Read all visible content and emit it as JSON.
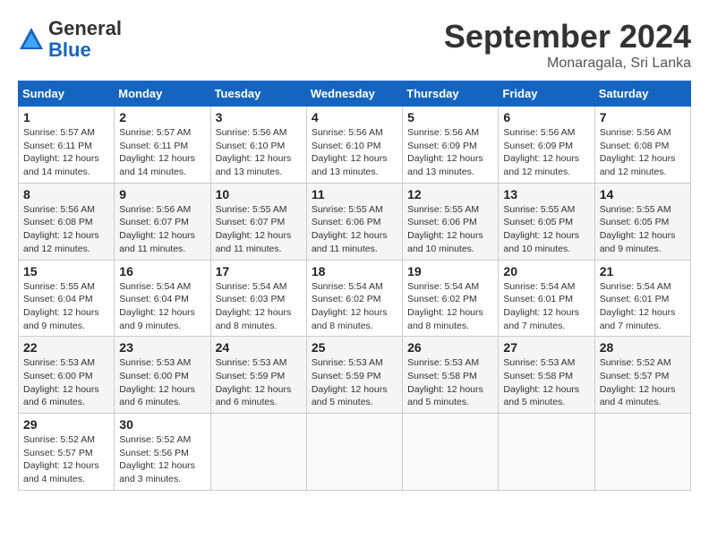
{
  "header": {
    "logo_line1": "General",
    "logo_line2": "Blue",
    "month": "September 2024",
    "location": "Monaragala, Sri Lanka"
  },
  "weekdays": [
    "Sunday",
    "Monday",
    "Tuesday",
    "Wednesday",
    "Thursday",
    "Friday",
    "Saturday"
  ],
  "weeks": [
    [
      {
        "day": "1",
        "info": "Sunrise: 5:57 AM\nSunset: 6:11 PM\nDaylight: 12 hours\nand 14 minutes."
      },
      {
        "day": "2",
        "info": "Sunrise: 5:57 AM\nSunset: 6:11 PM\nDaylight: 12 hours\nand 14 minutes."
      },
      {
        "day": "3",
        "info": "Sunrise: 5:56 AM\nSunset: 6:10 PM\nDaylight: 12 hours\nand 13 minutes."
      },
      {
        "day": "4",
        "info": "Sunrise: 5:56 AM\nSunset: 6:10 PM\nDaylight: 12 hours\nand 13 minutes."
      },
      {
        "day": "5",
        "info": "Sunrise: 5:56 AM\nSunset: 6:09 PM\nDaylight: 12 hours\nand 13 minutes."
      },
      {
        "day": "6",
        "info": "Sunrise: 5:56 AM\nSunset: 6:09 PM\nDaylight: 12 hours\nand 12 minutes."
      },
      {
        "day": "7",
        "info": "Sunrise: 5:56 AM\nSunset: 6:08 PM\nDaylight: 12 hours\nand 12 minutes."
      }
    ],
    [
      {
        "day": "8",
        "info": "Sunrise: 5:56 AM\nSunset: 6:08 PM\nDaylight: 12 hours\nand 12 minutes."
      },
      {
        "day": "9",
        "info": "Sunrise: 5:56 AM\nSunset: 6:07 PM\nDaylight: 12 hours\nand 11 minutes."
      },
      {
        "day": "10",
        "info": "Sunrise: 5:55 AM\nSunset: 6:07 PM\nDaylight: 12 hours\nand 11 minutes."
      },
      {
        "day": "11",
        "info": "Sunrise: 5:55 AM\nSunset: 6:06 PM\nDaylight: 12 hours\nand 11 minutes."
      },
      {
        "day": "12",
        "info": "Sunrise: 5:55 AM\nSunset: 6:06 PM\nDaylight: 12 hours\nand 10 minutes."
      },
      {
        "day": "13",
        "info": "Sunrise: 5:55 AM\nSunset: 6:05 PM\nDaylight: 12 hours\nand 10 minutes."
      },
      {
        "day": "14",
        "info": "Sunrise: 5:55 AM\nSunset: 6:05 PM\nDaylight: 12 hours\nand 9 minutes."
      }
    ],
    [
      {
        "day": "15",
        "info": "Sunrise: 5:55 AM\nSunset: 6:04 PM\nDaylight: 12 hours\nand 9 minutes."
      },
      {
        "day": "16",
        "info": "Sunrise: 5:54 AM\nSunset: 6:04 PM\nDaylight: 12 hours\nand 9 minutes."
      },
      {
        "day": "17",
        "info": "Sunrise: 5:54 AM\nSunset: 6:03 PM\nDaylight: 12 hours\nand 8 minutes."
      },
      {
        "day": "18",
        "info": "Sunrise: 5:54 AM\nSunset: 6:02 PM\nDaylight: 12 hours\nand 8 minutes."
      },
      {
        "day": "19",
        "info": "Sunrise: 5:54 AM\nSunset: 6:02 PM\nDaylight: 12 hours\nand 8 minutes."
      },
      {
        "day": "20",
        "info": "Sunrise: 5:54 AM\nSunset: 6:01 PM\nDaylight: 12 hours\nand 7 minutes."
      },
      {
        "day": "21",
        "info": "Sunrise: 5:54 AM\nSunset: 6:01 PM\nDaylight: 12 hours\nand 7 minutes."
      }
    ],
    [
      {
        "day": "22",
        "info": "Sunrise: 5:53 AM\nSunset: 6:00 PM\nDaylight: 12 hours\nand 6 minutes."
      },
      {
        "day": "23",
        "info": "Sunrise: 5:53 AM\nSunset: 6:00 PM\nDaylight: 12 hours\nand 6 minutes."
      },
      {
        "day": "24",
        "info": "Sunrise: 5:53 AM\nSunset: 5:59 PM\nDaylight: 12 hours\nand 6 minutes."
      },
      {
        "day": "25",
        "info": "Sunrise: 5:53 AM\nSunset: 5:59 PM\nDaylight: 12 hours\nand 5 minutes."
      },
      {
        "day": "26",
        "info": "Sunrise: 5:53 AM\nSunset: 5:58 PM\nDaylight: 12 hours\nand 5 minutes."
      },
      {
        "day": "27",
        "info": "Sunrise: 5:53 AM\nSunset: 5:58 PM\nDaylight: 12 hours\nand 5 minutes."
      },
      {
        "day": "28",
        "info": "Sunrise: 5:52 AM\nSunset: 5:57 PM\nDaylight: 12 hours\nand 4 minutes."
      }
    ],
    [
      {
        "day": "29",
        "info": "Sunrise: 5:52 AM\nSunset: 5:57 PM\nDaylight: 12 hours\nand 4 minutes."
      },
      {
        "day": "30",
        "info": "Sunrise: 5:52 AM\nSunset: 5:56 PM\nDaylight: 12 hours\nand 3 minutes."
      },
      {
        "day": "",
        "info": ""
      },
      {
        "day": "",
        "info": ""
      },
      {
        "day": "",
        "info": ""
      },
      {
        "day": "",
        "info": ""
      },
      {
        "day": "",
        "info": ""
      }
    ]
  ]
}
